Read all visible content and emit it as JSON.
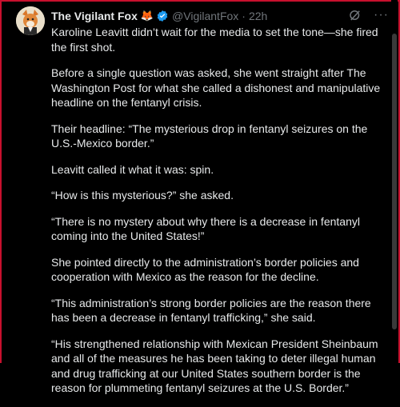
{
  "author": {
    "name": "The Vigilant Fox",
    "emoji": "🦊",
    "handle": "@VigilantFox",
    "separator": "·",
    "time": "22h"
  },
  "actions": {
    "grok_icon": "grok-icon",
    "more_label": "···"
  },
  "paragraphs": [
    "Karoline Leavitt didn’t wait for the media to set the tone—she fired the first shot.",
    "Before a single question was asked, she went straight after The Washington Post for what she called a dishonest and manipulative headline on the fentanyl crisis.",
    "Their headline: “The mysterious drop in fentanyl seizures on the U.S.-Mexico border.”",
    "Leavitt called it what it was: spin.",
    "“How is this mysterious?” she asked.",
    "“There is no mystery about why there is a decrease in fentanyl coming into the United States!”",
    "She pointed directly to the administration’s border policies and cooperation with Mexico as the reason for the decline.",
    "“This administration’s strong border policies are the reason there has been a decrease in fentanyl trafficking,” she said.",
    "“His strengthened relationship with Mexican President Sheinbaum and all of the measures he has been taking to deter illegal human and drug trafficking at our United States southern border is the reason for plummeting fentanyl seizures at the U.S. Border.”"
  ],
  "colors": {
    "background": "#000000",
    "text": "#e7e9ea",
    "muted": "#71767b",
    "verified": "#1d9bf0",
    "frame": "#c8102e"
  }
}
